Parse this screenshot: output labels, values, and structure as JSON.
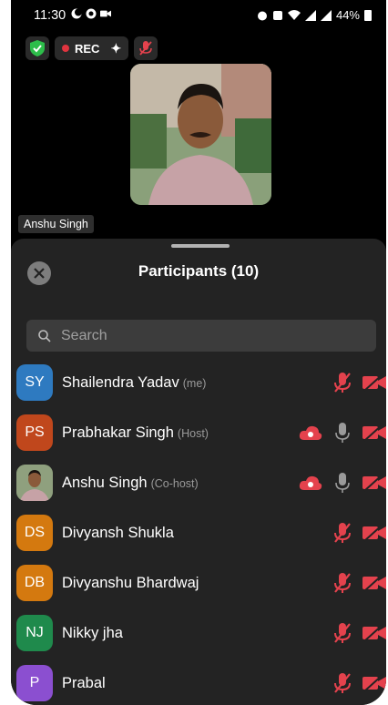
{
  "status_bar": {
    "time": "11:30",
    "battery": "44%"
  },
  "top_bar": {
    "rec_label": "REC"
  },
  "video": {
    "speaker_name": "Anshu Singh"
  },
  "panel": {
    "title": "Participants (10)",
    "search_placeholder": "Search"
  },
  "participants": [
    {
      "initials": "SY",
      "name": "Shailendra Yadav",
      "role": "(me)",
      "avatar_color": "#2e7ac0",
      "cloud": false,
      "mic": "muted",
      "video": "off"
    },
    {
      "initials": "PS",
      "name": "Prabhakar Singh",
      "role": "(Host)",
      "avatar_color": "#c0471c",
      "cloud": true,
      "mic": "on",
      "video": "off"
    },
    {
      "initials": "",
      "name": "Anshu Singh",
      "role": "(Co-host)",
      "avatar_color": "#6a7a5a",
      "photo": true,
      "cloud": true,
      "mic": "on",
      "video": "off"
    },
    {
      "initials": "DS",
      "name": "Divyansh Shukla",
      "role": "",
      "avatar_color": "#d4790f",
      "cloud": false,
      "mic": "muted",
      "video": "off"
    },
    {
      "initials": "DB",
      "name": "Divyanshu Bhardwaj",
      "role": "",
      "avatar_color": "#d4790f",
      "cloud": false,
      "mic": "muted",
      "video": "off"
    },
    {
      "initials": "NJ",
      "name": "Nikky jha",
      "role": "",
      "avatar_color": "#1f8a4c",
      "cloud": false,
      "mic": "muted",
      "video": "off"
    },
    {
      "initials": "P",
      "name": "Prabal",
      "role": "",
      "avatar_color": "#8b4fd0",
      "cloud": false,
      "mic": "muted",
      "video": "off"
    }
  ],
  "colors": {
    "muted_red": "#e4424d",
    "sheet_bg": "#232323",
    "search_bg": "#3c3c3c"
  }
}
